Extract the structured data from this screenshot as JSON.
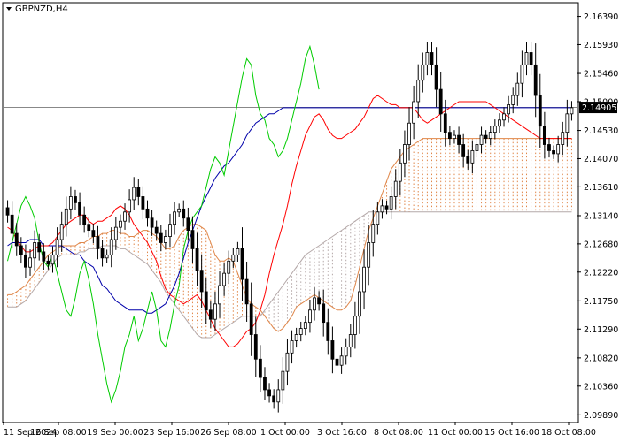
{
  "chart_data": {
    "type": "candlestick",
    "title": "GBPNZD,H4",
    "ylim": [
      2.0978,
      2.166
    ],
    "y_ticks": [
      "2.16390",
      "2.15930",
      "2.15460",
      "2.15000",
      "2.14530",
      "2.14070",
      "2.13610",
      "2.13140",
      "2.12680",
      "2.12220",
      "2.11750",
      "2.11290",
      "2.10820",
      "2.10360",
      "2.09890"
    ],
    "x_ticks": [
      "11 Sep 2024",
      "16 Sep 08:00",
      "19 Sep 00:00",
      "23 Sep 16:00",
      "26 Sep 08:00",
      "1 Oct 00:00",
      "3 Oct 16:00",
      "8 Oct 08:00",
      "11 Oct 00:00",
      "15 Oct 16:00",
      "18 Oct 08:00"
    ],
    "current_price": "2.14905",
    "colors": {
      "tenkan": "#ff0000",
      "kijun": "#0000aa",
      "chikou": "#00cc00",
      "senkou_a": "#e0874a",
      "senkou_b": "#b4a8a8",
      "candle": "#000000",
      "price_line": "#888888"
    },
    "close": [
      2.1315,
      2.1285,
      2.1265,
      2.125,
      2.123,
      2.1245,
      2.127,
      2.1255,
      2.124,
      2.1235,
      2.125,
      2.1275,
      2.13,
      2.1325,
      2.1345,
      2.1335,
      2.1315,
      2.13,
      2.129,
      2.128,
      2.126,
      2.1245,
      2.125,
      2.1275,
      2.1295,
      2.1305,
      2.132,
      2.134,
      2.136,
      2.1345,
      2.1325,
      2.131,
      2.1295,
      2.1285,
      2.127,
      2.128,
      2.13,
      2.132,
      2.1325,
      2.131,
      2.129,
      2.126,
      2.1225,
      2.119,
      2.116,
      2.1145,
      2.117,
      2.12,
      2.122,
      2.124,
      2.125,
      2.126,
      2.121,
      2.117,
      2.112,
      2.108,
      2.105,
      2.103,
      2.102,
      2.101,
      2.103,
      2.106,
      2.109,
      2.111,
      2.112,
      2.113,
      2.114,
      2.116,
      2.118,
      2.117,
      2.114,
      2.111,
      2.108,
      2.107,
      2.1085,
      2.11,
      2.112,
      2.115,
      2.119,
      2.123,
      2.127,
      2.13,
      2.132,
      2.133,
      2.1325,
      2.1345,
      2.137,
      2.14,
      2.143,
      2.1465,
      2.15,
      2.1535,
      2.156,
      2.158,
      2.156,
      2.152,
      2.148,
      2.145,
      2.144,
      2.1445,
      2.143,
      2.141,
      2.14,
      2.142,
      2.143,
      2.1445,
      2.144,
      2.145,
      2.146,
      2.147,
      2.148,
      2.1495,
      2.151,
      2.153,
      2.156,
      2.158,
      2.156,
      2.151,
      2.146,
      2.143,
      2.142,
      2.1415,
      2.143,
      2.145,
      2.148,
      2.149
    ],
    "tenkan": [
      2.1295,
      2.129,
      2.1275,
      2.1265,
      2.1255,
      2.1255,
      2.126,
      2.1265,
      2.1265,
      2.1265,
      2.127,
      2.128,
      2.129,
      2.13,
      2.1305,
      2.131,
      2.1315,
      2.1315,
      2.1305,
      2.13,
      2.1305,
      2.1305,
      2.131,
      2.1315,
      2.1325,
      2.133,
      2.1325,
      2.1315,
      2.13,
      2.129,
      2.128,
      2.127,
      2.1255,
      2.124,
      2.1215,
      2.1195,
      2.1185,
      2.118,
      2.1175,
      2.117,
      2.1175,
      2.118,
      2.1185,
      2.1175,
      2.116,
      2.1145,
      2.113,
      2.112,
      2.111,
      2.11,
      2.11,
      2.1105,
      2.1115,
      2.1125,
      2.113,
      2.114,
      2.116,
      2.1185,
      2.122,
      2.125,
      2.1275,
      2.13,
      2.133,
      2.1365,
      2.1395,
      2.142,
      2.1445,
      2.146,
      2.1475,
      2.148,
      2.147,
      2.1455,
      2.1445,
      2.144,
      2.144,
      2.1445,
      2.145,
      2.1455,
      2.1465,
      2.1475,
      2.149,
      2.1505,
      2.151,
      2.1505,
      2.15,
      2.1495,
      2.1495,
      2.149,
      2.149,
      2.149,
      2.149,
      2.148,
      2.147,
      2.1465,
      2.147,
      2.1475,
      2.148,
      2.1485,
      2.149,
      2.1495,
      2.15,
      2.15,
      2.15,
      2.15,
      2.15,
      2.15,
      2.15,
      2.1495,
      2.149,
      2.1485,
      2.148,
      2.1475,
      2.147,
      2.1465,
      2.146,
      2.1455,
      2.145,
      2.1445,
      2.144,
      2.144,
      2.144,
      2.144,
      2.144,
      2.144,
      2.144,
      2.144
    ],
    "kijun": [
      2.1265,
      2.127,
      2.127,
      2.127,
      2.127,
      2.1275,
      2.1275,
      2.1275,
      2.1265,
      2.1265,
      2.1265,
      2.1265,
      2.1265,
      2.126,
      2.1255,
      2.125,
      2.125,
      2.124,
      2.1235,
      2.123,
      2.1215,
      2.12,
      2.1195,
      2.1185,
      2.1175,
      2.117,
      2.1165,
      2.116,
      2.116,
      2.116,
      2.116,
      2.1155,
      2.1155,
      2.116,
      2.1165,
      2.117,
      2.1185,
      2.12,
      2.122,
      2.1245,
      2.127,
      2.129,
      2.131,
      2.133,
      2.1345,
      2.136,
      2.1375,
      2.1385,
      2.1395,
      2.14,
      2.141,
      2.142,
      2.143,
      2.1445,
      2.1455,
      2.1465,
      2.147,
      2.1475,
      2.148,
      2.148,
      2.1485,
      2.149,
      2.149,
      2.149,
      2.149,
      2.149,
      2.149,
      2.149,
      2.149,
      2.149,
      2.149,
      2.149,
      2.149,
      2.149,
      2.149,
      2.149,
      2.149,
      2.149,
      2.149,
      2.149,
      2.149,
      2.149,
      2.149,
      2.149,
      2.149,
      2.149,
      2.149,
      2.149,
      2.149,
      2.149,
      2.149,
      2.149,
      2.149,
      2.149,
      2.149,
      2.149,
      2.149,
      2.149,
      2.149,
      2.149,
      2.149,
      2.149,
      2.149,
      2.149,
      2.149,
      2.149,
      2.149,
      2.149,
      2.149,
      2.149,
      2.149,
      2.149,
      2.149,
      2.149,
      2.149,
      2.149,
      2.149,
      2.149,
      2.149,
      2.149,
      2.149,
      2.149,
      2.149,
      2.149,
      2.149,
      2.149
    ],
    "senkou_a": [
      2.1185,
      2.1185,
      2.119,
      2.1195,
      2.12,
      2.121,
      2.122,
      2.123,
      2.124,
      2.125,
      2.1255,
      2.126,
      2.1265,
      2.1265,
      2.1265,
      2.1265,
      2.127,
      2.127,
      2.1275,
      2.128,
      2.128,
      2.1285,
      2.1285,
      2.129,
      2.129,
      2.1285,
      2.1285,
      2.128,
      2.128,
      2.1285,
      2.129,
      2.129,
      2.1285,
      2.128,
      2.127,
      2.126,
      2.126,
      2.1265,
      2.128,
      2.129,
      2.1295,
      2.13,
      2.13,
      2.1295,
      2.129,
      2.127,
      2.125,
      2.124,
      2.124,
      2.1245,
      2.124,
      2.122,
      2.12,
      2.118,
      2.117,
      2.1165,
      2.116,
      2.115,
      2.114,
      2.113,
      2.1125,
      2.113,
      2.114,
      2.115,
      2.1165,
      2.117,
      2.1175,
      2.118,
      2.1185,
      2.118,
      2.1175,
      2.117,
      2.1165,
      2.116,
      2.116,
      2.1165,
      2.1175,
      2.12,
      2.123,
      2.126,
      2.129,
      2.131,
      2.133,
      2.135,
      2.137,
      2.139,
      2.14,
      2.141,
      2.142,
      2.1425,
      2.143,
      2.1435,
      2.144,
      2.144,
      2.144,
      2.144,
      2.144,
      2.144,
      2.144,
      2.144,
      2.144,
      2.144,
      2.144,
      2.144,
      2.144,
      2.144,
      2.144,
      2.144,
      2.144,
      2.144,
      2.144,
      2.144,
      2.144,
      2.144,
      2.144,
      2.144,
      2.144,
      2.144,
      2.144,
      2.144,
      2.144,
      2.144,
      2.144,
      2.144,
      2.144,
      2.144
    ],
    "senkou_b": [
      2.1165,
      2.1165,
      2.1165,
      2.117,
      2.1175,
      2.1185,
      2.1195,
      2.1205,
      2.1215,
      2.1225,
      2.1235,
      2.1245,
      2.125,
      2.125,
      2.125,
      2.125,
      2.1255,
      2.1255,
      2.126,
      2.126,
      2.126,
      2.1265,
      2.1265,
      2.1265,
      2.1265,
      2.126,
      2.126,
      2.1255,
      2.125,
      2.1245,
      2.124,
      2.1235,
      2.1225,
      2.1215,
      2.1205,
      2.119,
      2.118,
      2.117,
      2.116,
      2.115,
      2.114,
      2.113,
      2.112,
      2.1115,
      2.1115,
      2.1115,
      2.112,
      2.1125,
      2.113,
      2.1135,
      2.114,
      2.1145,
      2.115,
      2.115,
      2.115,
      2.115,
      2.115,
      2.116,
      2.117,
      2.118,
      2.119,
      2.12,
      2.121,
      2.122,
      2.123,
      2.124,
      2.125,
      2.1255,
      2.126,
      2.1265,
      2.127,
      2.1275,
      2.128,
      2.1285,
      2.129,
      2.1295,
      2.13,
      2.1305,
      2.131,
      2.1315,
      2.132,
      2.132,
      2.132,
      2.132,
      2.132,
      2.132,
      2.132,
      2.132,
      2.132,
      2.132,
      2.132,
      2.132,
      2.132,
      2.132,
      2.132,
      2.132,
      2.132,
      2.132,
      2.132,
      2.132,
      2.132,
      2.132,
      2.132,
      2.132,
      2.132,
      2.132,
      2.132,
      2.132,
      2.132,
      2.132,
      2.132,
      2.132,
      2.132,
      2.132,
      2.132,
      2.132,
      2.132,
      2.132,
      2.132,
      2.132,
      2.132,
      2.132,
      2.132,
      2.132,
      2.132,
      2.132
    ],
    "chikou": [
      2.124,
      2.127,
      2.13,
      2.133,
      2.1345,
      2.133,
      2.131,
      2.127,
      2.124,
      2.123,
      2.125,
      2.122,
      2.119,
      2.116,
      2.115,
      2.118,
      2.122,
      2.124,
      2.121,
      2.117,
      2.112,
      2.108,
      2.104,
      2.101,
      2.103,
      2.106,
      2.11,
      2.112,
      2.115,
      2.111,
      2.113,
      2.116,
      2.119,
      2.116,
      2.111,
      2.11,
      2.113,
      2.117,
      2.12,
      2.126,
      2.129,
      2.131,
      2.132,
      2.133,
      2.136,
      2.139,
      2.141,
      2.14,
      2.138,
      2.142,
      2.146,
      2.15,
      2.154,
      2.157,
      2.156,
      2.151,
      2.148,
      2.147,
      2.144,
      2.143,
      2.141,
      2.142,
      2.144,
      2.147,
      2.15,
      2.153,
      2.157,
      2.159,
      2.156,
      2.152
    ]
  }
}
